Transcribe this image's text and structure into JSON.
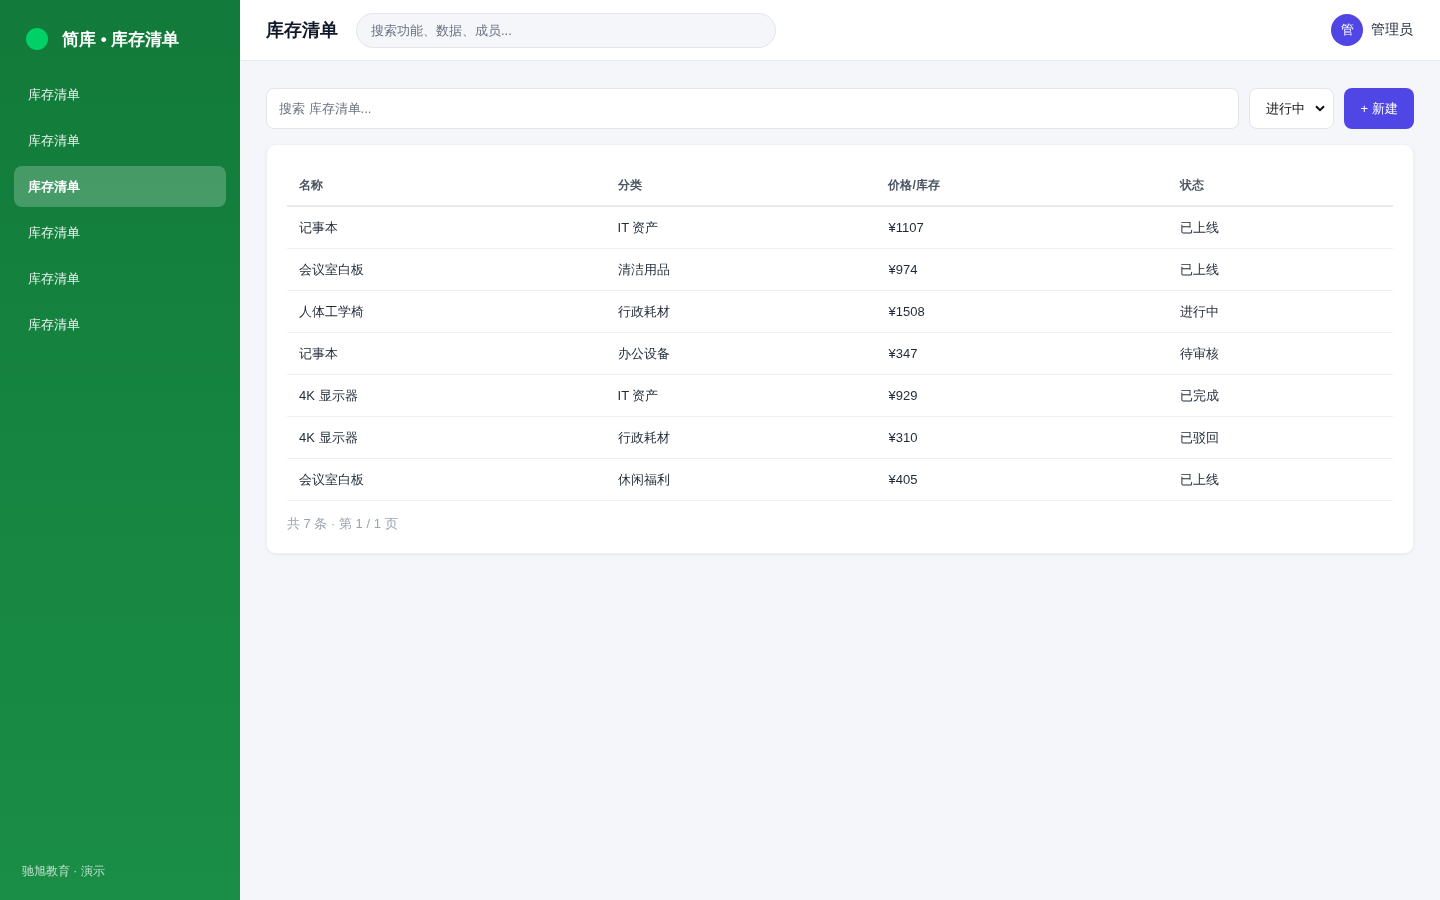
{
  "sidebar": {
    "brand": {
      "title": "简库 • 库存清单"
    },
    "items": [
      {
        "label": "库存清单",
        "selected": false
      },
      {
        "label": "库存清单",
        "selected": false
      },
      {
        "label": "库存清单",
        "selected": true
      },
      {
        "label": "库存清单",
        "selected": false
      },
      {
        "label": "库存清单",
        "selected": false
      },
      {
        "label": "库存清单",
        "selected": false
      }
    ],
    "footer": "驰旭教育 · 演示"
  },
  "topbar": {
    "title": "库存清单",
    "search": {
      "placeholder": "搜索功能、数据、成员..."
    },
    "user": {
      "avatar": "管",
      "name": "管理员"
    }
  },
  "toolbar": {
    "search": {
      "placeholder": "搜索 库存清单..."
    },
    "filter": {
      "value": "进行中"
    },
    "new_button": "+ 新建"
  },
  "table": {
    "columns": [
      "名称",
      "分类",
      "价格/库存",
      "状态"
    ],
    "rows": [
      [
        "记事本",
        "IT 资产",
        "¥1107",
        "已上线"
      ],
      [
        "会议室白板",
        "清洁用品",
        "¥974",
        "已上线"
      ],
      [
        "人体工学椅",
        "行政耗材",
        "¥1508",
        "进行中"
      ],
      [
        "记事本",
        "办公设备",
        "¥347",
        "待审核"
      ],
      [
        "4K 显示器",
        "IT 资产",
        "¥929",
        "已完成"
      ],
      [
        "4K 显示器",
        "行政耗材",
        "¥310",
        "已驳回"
      ],
      [
        "会议室白板",
        "休闲福利",
        "¥405",
        "已上线"
      ]
    ],
    "footer": "共 7 条 · 第 1 / 1 页"
  }
}
